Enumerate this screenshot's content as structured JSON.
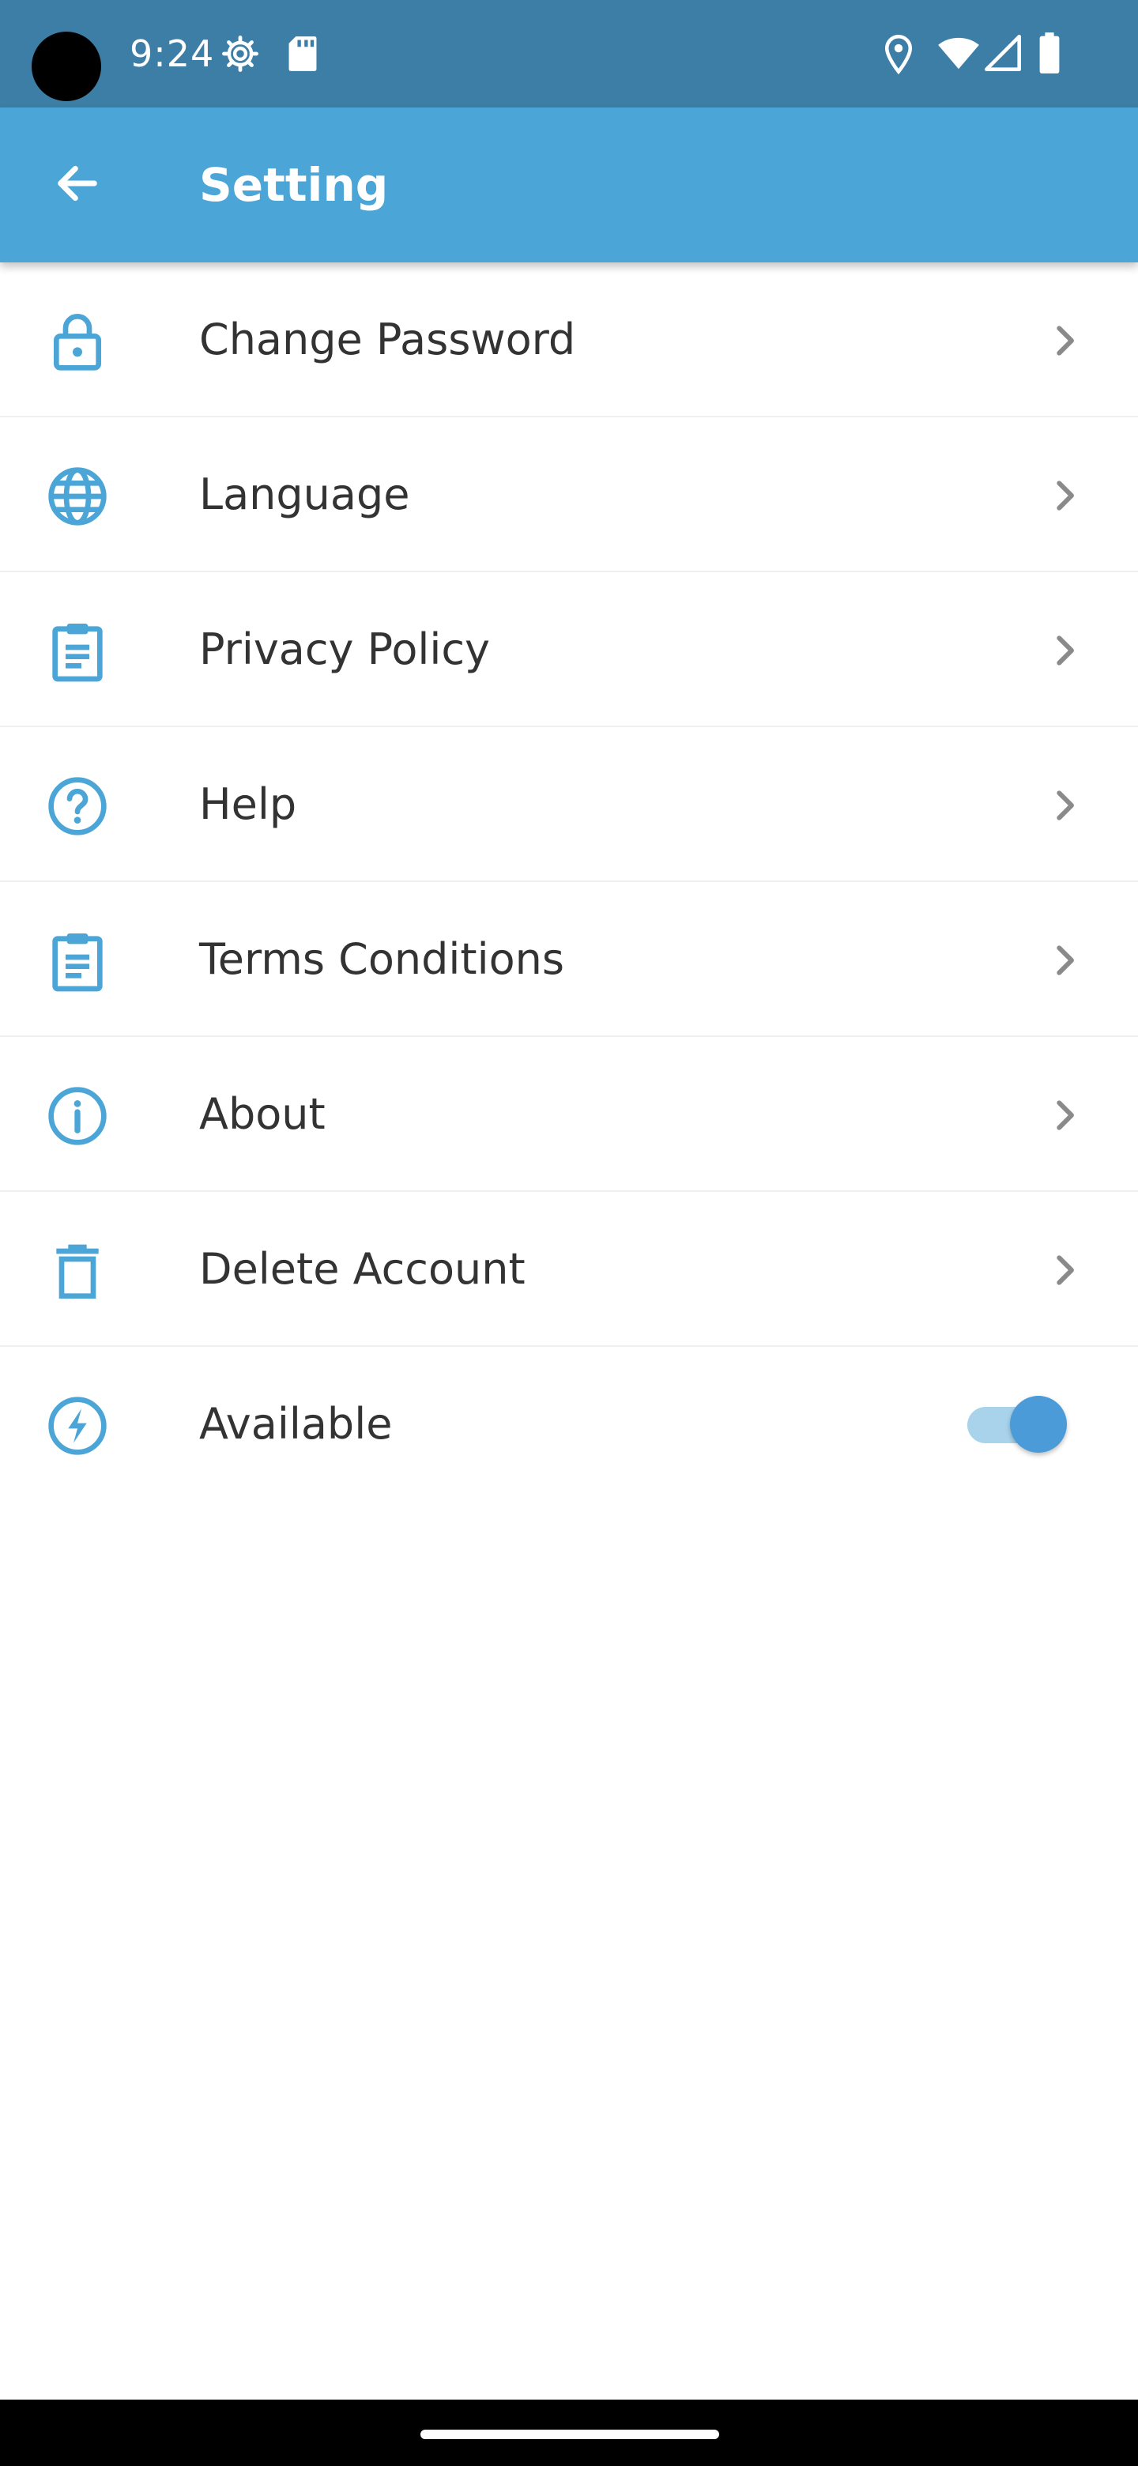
{
  "status_bar": {
    "time": "9:24",
    "left_icons": [
      "settings-gear-icon",
      "sd-card-icon"
    ],
    "right_icons": [
      "location-icon",
      "wifi-icon",
      "signal-icon",
      "battery-icon"
    ],
    "background": "#3d7ea6"
  },
  "app_bar": {
    "title": "Setting",
    "back_icon": "arrow-back-icon",
    "background": "#4ba5d6"
  },
  "settings": {
    "icon_color": "#4ba5d6",
    "items": [
      {
        "label": "Change Password",
        "icon": "lock-icon",
        "trailing": "chevron-right-icon"
      },
      {
        "label": "Language",
        "icon": "globe-icon",
        "trailing": "chevron-right-icon"
      },
      {
        "label": "Privacy Policy",
        "icon": "clipboard-icon",
        "trailing": "chevron-right-icon"
      },
      {
        "label": "Help",
        "icon": "help-circle-icon",
        "trailing": "chevron-right-icon"
      },
      {
        "label": "Terms Conditions",
        "icon": "clipboard-icon",
        "trailing": "chevron-right-icon"
      },
      {
        "label": "About",
        "icon": "info-circle-icon",
        "trailing": "chevron-right-icon"
      },
      {
        "label": "Delete Account",
        "icon": "trash-icon",
        "trailing": "chevron-right-icon"
      },
      {
        "label": "Available",
        "icon": "lightning-circle-icon",
        "trailing": "toggle",
        "toggle_on": true
      }
    ]
  }
}
